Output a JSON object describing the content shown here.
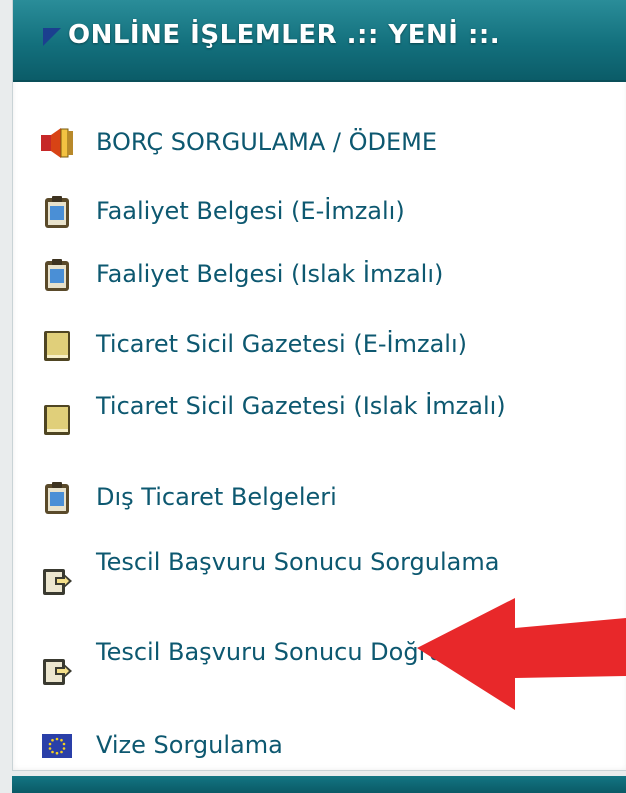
{
  "header": {
    "title": "ONLİNE İŞLEMLER .:: YENİ ::."
  },
  "items": [
    {
      "label": "BORÇ SORGULAMA / ÖDEME",
      "icon": "money-speaker-icon"
    },
    {
      "label": "Faaliyet Belgesi (E-İmzalı)",
      "icon": "clipboard-document-icon"
    },
    {
      "label": "Faaliyet Belgesi (Islak İmzalı)",
      "icon": "clipboard-document-icon"
    },
    {
      "label": "Ticaret Sicil Gazetesi (E-İmzalı)",
      "icon": "book-icon"
    },
    {
      "label": "Ticaret Sicil Gazetesi (Islak İmzalı)",
      "icon": "book-icon"
    },
    {
      "label": "Dış Ticaret Belgeleri",
      "icon": "clipboard-document-icon"
    },
    {
      "label": "Tescil Başvuru Sonucu Sorgulama",
      "icon": "document-arrow-icon"
    },
    {
      "label": "Tescil Başvuru Sonucu Doğrulama",
      "icon": "document-arrow-icon"
    },
    {
      "label": "Vize Sorgulama",
      "icon": "eu-flag-icon"
    }
  ],
  "colors": {
    "header": "#13707d",
    "link": "#0d5870",
    "arrow": "#e8282a"
  }
}
